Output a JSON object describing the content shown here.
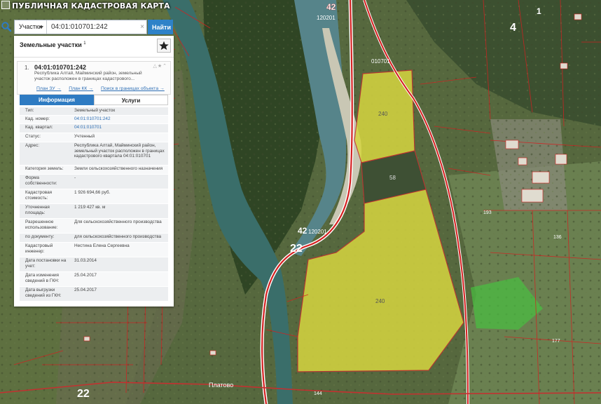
{
  "app": {
    "title": "ПУБЛИЧНАЯ КАДАСТРОВАЯ КАРТА"
  },
  "search": {
    "type_label": "Участки",
    "value": "04:01:010701:242",
    "clear": "×",
    "button": "Найти"
  },
  "panel": {
    "title": "Земельные участки",
    "count": "1",
    "result": {
      "number": "1.",
      "id": "04:01:010701:242",
      "address": "Республика Алтай, Майминский район, земельный участок расположен в границах кадастрового...",
      "links": [
        "План ЗУ →",
        "План КК →",
        "Поиск в границах объекта →"
      ]
    },
    "tabs": [
      "Информация",
      "Услуги"
    ],
    "attributes": [
      {
        "key": "Тип:",
        "value": "Земельный участок",
        "link": false
      },
      {
        "key": "Кад. номер:",
        "value": "04:01:010701:242",
        "link": true
      },
      {
        "key": "Кад. квартал:",
        "value": "04:01:010701",
        "link": true
      },
      {
        "key": "Статус:",
        "value": "Учтенный",
        "link": false
      },
      {
        "key": "Адрес:",
        "value": "Республика Алтай, Майминский район, земельный участок расположен в границах кадастрового квартала 04:01:010701",
        "link": false
      },
      {
        "key": "Категория земель:",
        "value": "Земли сельскохозяйственного назначения",
        "link": false
      },
      {
        "key": "Форма собственности:",
        "value": "-",
        "link": false
      },
      {
        "key": "Кадастровая стоимость:",
        "value": "1 926 694,66 руб.",
        "link": false
      },
      {
        "key": "Уточненная площадь:",
        "value": "1 219 427 кв. м",
        "link": false
      },
      {
        "key": "Разрешенное использование:",
        "value": "Для сельскохозяйственного производства",
        "link": false
      },
      {
        "key": "по документу:",
        "value": "для сельскохозяйственного производства",
        "link": false
      },
      {
        "key": "Кадастровый инженер:",
        "value": "Нестина Елена Сергеевна",
        "link": false
      },
      {
        "key": "Дата постановки на учет:",
        "value": "31.03.2014",
        "link": false
      },
      {
        "key": "Дата изменения сведений в ГКН:",
        "value": "25.04.2017",
        "link": false
      },
      {
        "key": "Дата выгрузки сведений из ГКН:",
        "value": "25.04.2017",
        "link": false
      }
    ]
  },
  "map_labels": [
    {
      "text": "42"
    },
    {
      "text": "120201"
    },
    {
      "text": "010701"
    },
    {
      "text": "240"
    },
    {
      "text": "58"
    },
    {
      "text": "240"
    },
    {
      "text": "42"
    },
    {
      "text": "120201"
    },
    {
      "text": "22"
    },
    {
      "text": "22"
    },
    {
      "text": "4"
    },
    {
      "text": "1"
    },
    {
      "text": "193"
    },
    {
      "text": "136"
    },
    {
      "text": "144"
    },
    {
      "text": "177"
    },
    {
      "text": "Платово"
    }
  ],
  "colors": {
    "accent": "#2e7bc2",
    "parcel_fill": "#d6d640",
    "boundary": "#d42020"
  }
}
